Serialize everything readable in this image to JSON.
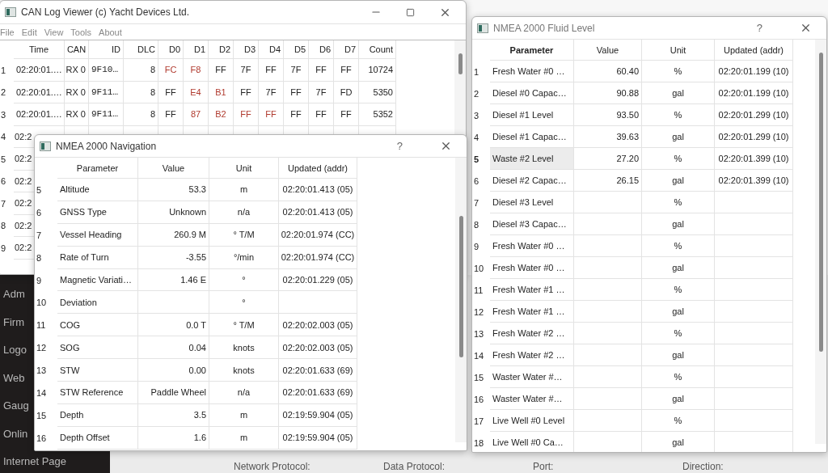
{
  "background_page": {
    "sidebar": {
      "items": [
        "Adm",
        "Firm",
        "Logo",
        "Web",
        "Gaug",
        "Onlin",
        "Internet Page"
      ]
    },
    "labels": [
      "Network Protocol:",
      "Data Protocol:",
      "Port:",
      "Direction:"
    ]
  },
  "can_window": {
    "title": "CAN Log Viewer (c) Yacht Devices Ltd.",
    "menu": [
      "File",
      "Edit",
      "View",
      "Tools",
      "About"
    ],
    "columns": [
      "Time",
      "CAN",
      "ID",
      "DLC",
      "D0",
      "D1",
      "D2",
      "D3",
      "D4",
      "D5",
      "D6",
      "D7",
      "Count"
    ],
    "rows": [
      {
        "num": "1",
        "time": "02:20:01.…",
        "can": "RX 0",
        "id": "9F10…",
        "dlc": "8",
        "data": [
          {
            "v": "FC",
            "changed": true
          },
          {
            "v": "F8",
            "changed": true
          },
          {
            "v": "FF",
            "changed": false
          },
          {
            "v": "7F",
            "changed": false
          },
          {
            "v": "FF",
            "changed": false
          },
          {
            "v": "7F",
            "changed": false
          },
          {
            "v": "FF",
            "changed": false
          },
          {
            "v": "FF",
            "changed": false
          }
        ],
        "count": "10724"
      },
      {
        "num": "2",
        "time": "02:20:01.…",
        "can": "RX 0",
        "id": "9F11…",
        "dlc": "8",
        "data": [
          {
            "v": "FF",
            "changed": false
          },
          {
            "v": "E4",
            "changed": true
          },
          {
            "v": "B1",
            "changed": true
          },
          {
            "v": "FF",
            "changed": false
          },
          {
            "v": "7F",
            "changed": false
          },
          {
            "v": "FF",
            "changed": false
          },
          {
            "v": "7F",
            "changed": false
          },
          {
            "v": "FD",
            "changed": false
          }
        ],
        "count": "5350"
      },
      {
        "num": "3",
        "time": "02:20:01.…",
        "can": "RX 0",
        "id": "9F11…",
        "dlc": "8",
        "data": [
          {
            "v": "FF",
            "changed": false
          },
          {
            "v": "87",
            "changed": true
          },
          {
            "v": "B2",
            "changed": true
          },
          {
            "v": "FF",
            "changed": true
          },
          {
            "v": "FF",
            "changed": true
          },
          {
            "v": "FF",
            "changed": false
          },
          {
            "v": "FF",
            "changed": false
          },
          {
            "v": "FF",
            "changed": false
          }
        ],
        "count": "5352"
      },
      {
        "num": "4",
        "time": "02:2"
      },
      {
        "num": "5",
        "time": "02:2"
      },
      {
        "num": "6",
        "time": "02:2"
      },
      {
        "num": "7",
        "time": "02:2"
      },
      {
        "num": "8",
        "time": "02:2"
      },
      {
        "num": "9",
        "time": "02:2"
      }
    ]
  },
  "navigation_window": {
    "title": "NMEA 2000 Navigation",
    "help": "?",
    "columns": [
      "Parameter",
      "Value",
      "Unit",
      "Updated (addr)"
    ],
    "rows": [
      {
        "num": "5",
        "parameter": "Altitude",
        "value": "53.3",
        "unit": "m",
        "updated": "02:20:01.413 (05)"
      },
      {
        "num": "6",
        "parameter": "GNSS Type",
        "value": "Unknown",
        "unit": "n/a",
        "updated": "02:20:01.413 (05)"
      },
      {
        "num": "7",
        "parameter": "Vessel Heading",
        "value": "260.9 M",
        "unit": "° T/M",
        "updated": "02:20:01.974 (CC)"
      },
      {
        "num": "8",
        "parameter": "Rate of Turn",
        "value": "-3.55",
        "unit": "°/min",
        "updated": "02:20:01.974 (CC)"
      },
      {
        "num": "9",
        "parameter": "Magnetic Variati…",
        "value": "1.46 E",
        "unit": "°",
        "updated": "02:20:01.229 (05)"
      },
      {
        "num": "10",
        "parameter": "Deviation",
        "unit": "°"
      },
      {
        "num": "11",
        "parameter": "COG",
        "value": "0.0 T",
        "unit": "° T/M",
        "updated": "02:20:02.003 (05)"
      },
      {
        "num": "12",
        "parameter": "SOG",
        "value": "0.04",
        "unit": "knots",
        "updated": "02:20:02.003 (05)"
      },
      {
        "num": "13",
        "parameter": "STW",
        "value": "0.00",
        "unit": "knots",
        "updated": "02:20:01.633 (69)"
      },
      {
        "num": "14",
        "parameter": "STW Reference",
        "value": "Paddle Wheel",
        "unit": "n/a",
        "updated": "02:20:01.633 (69)"
      },
      {
        "num": "15",
        "parameter": "Depth",
        "value": "3.5",
        "unit": "m",
        "updated": "02:19:59.904 (05)"
      },
      {
        "num": "16",
        "parameter": "Depth Offset",
        "value": "1.6",
        "unit": "m",
        "updated": "02:19:59.904 (05)"
      }
    ]
  },
  "fluid_window": {
    "title": "NMEA 2000 Fluid Level",
    "help": "?",
    "columns": [
      "Parameter",
      "Value",
      "Unit",
      "Updated (addr)"
    ],
    "rows": [
      {
        "num": "1",
        "parameter": "Fresh Water #0 …",
        "value": "60.40",
        "unit": "%",
        "updated": "02:20:01.199 (10)",
        "selected": false
      },
      {
        "num": "2",
        "parameter": "Diesel #0 Capac…",
        "value": "90.88",
        "unit": "gal",
        "updated": "02:20:01.199 (10)",
        "selected": false
      },
      {
        "num": "3",
        "parameter": "Diesel #1 Level",
        "value": "93.50",
        "unit": "%",
        "updated": "02:20:01.299 (10)",
        "selected": false
      },
      {
        "num": "4",
        "parameter": "Diesel #1 Capac…",
        "value": "39.63",
        "unit": "gal",
        "updated": "02:20:01.299 (10)",
        "selected": false
      },
      {
        "num": "5",
        "parameter": "Waste #2 Level",
        "value": "27.20",
        "unit": "%",
        "updated": "02:20:01.399 (10)",
        "selected": true
      },
      {
        "num": "6",
        "parameter": "Diesel #2 Capac…",
        "value": "26.15",
        "unit": "gal",
        "updated": "02:20:01.399 (10)",
        "selected": false
      },
      {
        "num": "7",
        "parameter": "Diesel #3 Level",
        "unit": "%",
        "selected": false
      },
      {
        "num": "8",
        "parameter": "Diesel #3 Capac…",
        "unit": "gal",
        "selected": false
      },
      {
        "num": "9",
        "parameter": "Fresh Water #0 …",
        "unit": "%",
        "selected": false
      },
      {
        "num": "10",
        "parameter": "Fresh Water #0 …",
        "unit": "gal",
        "selected": false
      },
      {
        "num": "11",
        "parameter": "Fresh Water #1 …",
        "unit": "%",
        "selected": false
      },
      {
        "num": "12",
        "parameter": "Fresh Water #1 …",
        "unit": "gal",
        "selected": false
      },
      {
        "num": "13",
        "parameter": "Fresh Water #2 …",
        "unit": "%",
        "selected": false
      },
      {
        "num": "14",
        "parameter": "Fresh Water #2 …",
        "unit": "gal",
        "selected": false
      },
      {
        "num": "15",
        "parameter": "Waster Water #…",
        "unit": "%",
        "selected": false
      },
      {
        "num": "16",
        "parameter": "Waster Water #…",
        "unit": "gal",
        "selected": false
      },
      {
        "num": "17",
        "parameter": "Live Well #0 Level",
        "unit": "%",
        "selected": false
      },
      {
        "num": "18",
        "parameter": "Live Well #0 Ca…",
        "unit": "gal",
        "selected": false
      }
    ]
  }
}
